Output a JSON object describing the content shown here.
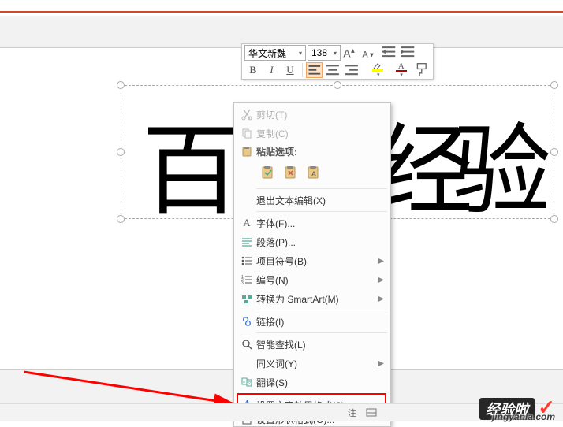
{
  "mini_toolbar": {
    "font_name": "华文新魏",
    "font_size": "138",
    "bold": "B",
    "italic": "I",
    "underline": "U",
    "highlight_color": "#ffff00",
    "font_color": "#c00000"
  },
  "textbox_glyphs": {
    "g1": "百",
    "g3": "经",
    "g4": "验"
  },
  "context_menu": {
    "cut": "剪切(T)",
    "copy": "复制(C)",
    "paste_header": "粘贴选项:",
    "exit_text_edit": "退出文本编辑(X)",
    "font": "字体(F)...",
    "paragraph": "段落(P)...",
    "bullets": "项目符号(B)",
    "numbering": "编号(N)",
    "convert_smartart": "转换为 SmartArt(M)",
    "hyperlink": "链接(I)",
    "smart_lookup": "智能查找(L)",
    "synonyms": "同义词(Y)",
    "translate": "翻译(S)",
    "format_text_effects": "设置文字效果格式(S)...",
    "format_shape": "设置形状格式(O)..."
  },
  "status": {
    "notes_label": "注"
  },
  "watermark": {
    "badge": "经验啦",
    "url": "jingyanla.com"
  }
}
